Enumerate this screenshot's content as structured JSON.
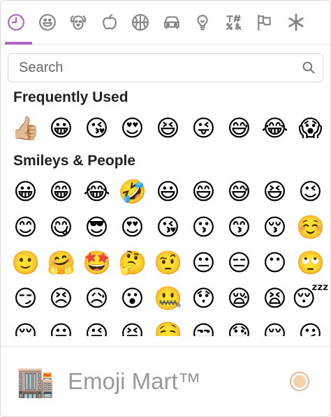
{
  "categories": [
    {
      "name": "recent",
      "icon": "clock-icon",
      "active": true
    },
    {
      "name": "people",
      "icon": "smiley-icon"
    },
    {
      "name": "nature",
      "icon": "dog-icon"
    },
    {
      "name": "foods",
      "icon": "apple-icon"
    },
    {
      "name": "activity",
      "icon": "ball-icon"
    },
    {
      "name": "places",
      "icon": "car-icon"
    },
    {
      "name": "objects",
      "icon": "bulb-icon"
    },
    {
      "name": "symbols",
      "icon": "symbols-icon"
    },
    {
      "name": "flags",
      "icon": "flag-icon"
    },
    {
      "name": "custom",
      "icon": "asterisk-icon"
    }
  ],
  "search": {
    "placeholder": "Search"
  },
  "sections": [
    {
      "title": "Frequently Used",
      "emojis": [
        "👍🏼",
        "😀",
        "😘",
        "😍",
        "😆",
        "😜",
        "😅",
        "😂",
        "😱"
      ]
    },
    {
      "title": "Smileys & People",
      "emojis": [
        "😀",
        "😁",
        "😂",
        "🤣",
        "😃",
        "😄",
        "😅",
        "😆",
        "😉",
        "😊",
        "😋",
        "😎",
        "😍",
        "😘",
        "😗",
        "😙",
        "😚",
        "☺️",
        "🙂",
        "🤗",
        "🤩",
        "🤔",
        "🤨",
        "😐",
        "😑",
        "😶",
        "🙄",
        "😏",
        "😣",
        "😥",
        "😮",
        "🤐",
        "😯",
        "😪",
        "😫",
        "😴",
        "😌",
        "😛",
        "😜",
        "😝",
        "🤤",
        "😒",
        "😓",
        "😔",
        "😕"
      ]
    }
  ],
  "preview": {
    "emoji": "🏬",
    "title": "Emoji Mart™",
    "skin_color": "#f5d0a9"
  }
}
